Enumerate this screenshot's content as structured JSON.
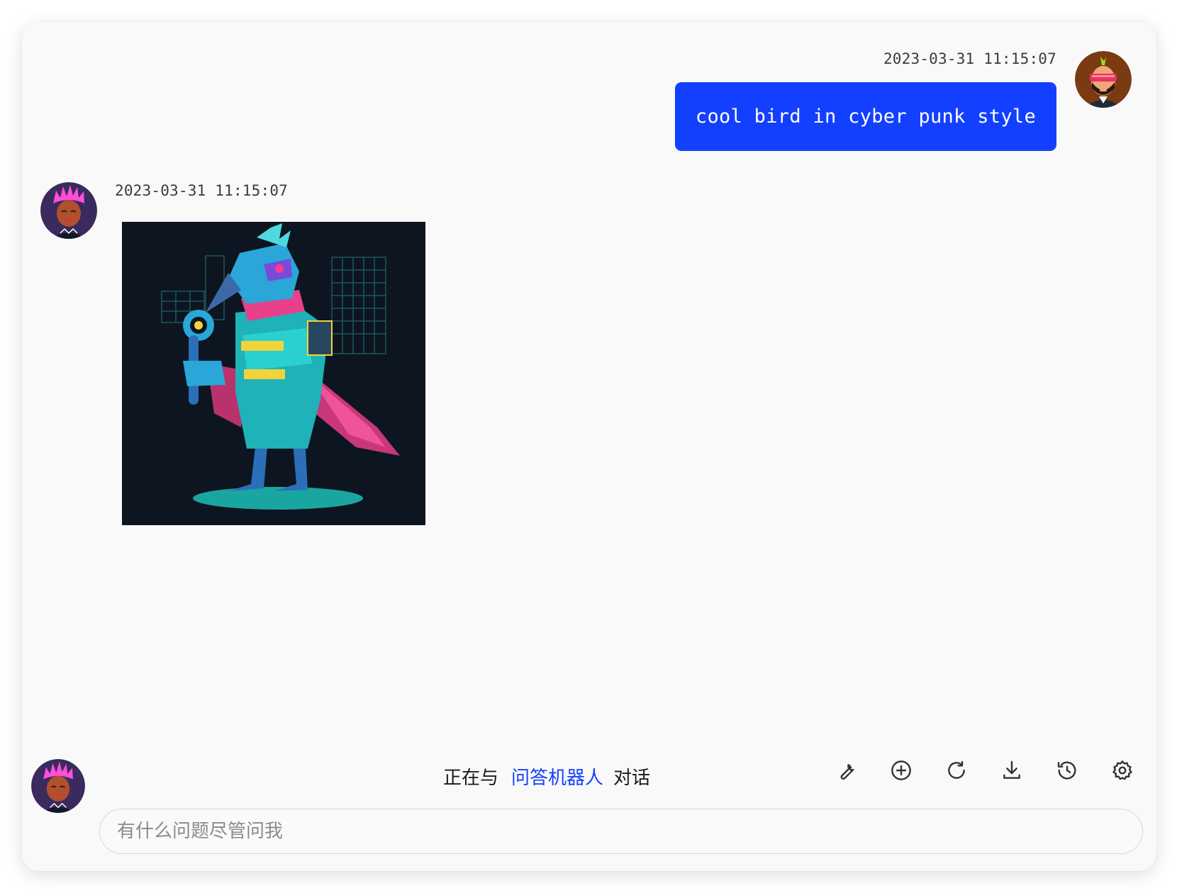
{
  "conversation": {
    "user_message": {
      "timestamp": "2023-03-31 11:15:07",
      "text": "cool bird in cyber punk style",
      "avatar_icon": "user-avatar-sunglasses-beard"
    },
    "bot_message": {
      "timestamp": "2023-03-31 11:15:07",
      "image_icon": "cyberpunk-bird-illustration",
      "avatar_icon": "bot-avatar-pink-hair"
    }
  },
  "status": {
    "prefix": "正在与",
    "bot_name": "问答机器人",
    "suffix": "对话"
  },
  "toolbar": {
    "items": [
      {
        "icon": "wrench-icon"
      },
      {
        "icon": "plus-circle-icon"
      },
      {
        "icon": "refresh-icon"
      },
      {
        "icon": "download-icon"
      },
      {
        "icon": "history-icon"
      },
      {
        "icon": "gear-icon"
      }
    ]
  },
  "input": {
    "placeholder": "有什么问题尽管问我",
    "value": ""
  },
  "colors": {
    "accent": "#1340ff",
    "window_background": "#f9f9f9",
    "timestamp_text": "#3a3a44"
  }
}
